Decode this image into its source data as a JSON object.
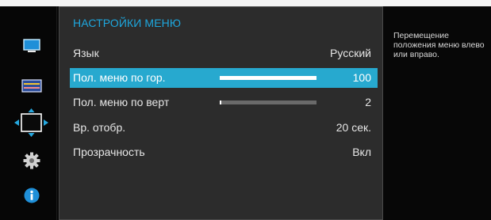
{
  "menu": {
    "title": "НАСТРОЙКИ МЕНЮ",
    "rows": [
      {
        "label": "Язык",
        "value": "Русский",
        "selected": false
      },
      {
        "label": "Пол. меню по гор.",
        "value": "100",
        "slider_fraction": 1.0,
        "selected": true
      },
      {
        "label": "Пол. меню по верт",
        "value": "2",
        "slider_fraction": 0.02,
        "selected": false
      },
      {
        "label": "Вр. отобр.",
        "value": "20 сек.",
        "selected": false
      },
      {
        "label": "Прозрачность",
        "value": "Вкл",
        "selected": false
      }
    ]
  },
  "help": {
    "text": "Перемещение положения меню влево или вправо."
  },
  "sidebar": {
    "icons": [
      "display-icon",
      "picture-icon",
      "position-icon",
      "gear-icon",
      "info-icon"
    ]
  },
  "colors": {
    "title": "#1ea7de",
    "selection": "#27a9cf",
    "panel": "#2c2c2c",
    "background": "#070707"
  }
}
